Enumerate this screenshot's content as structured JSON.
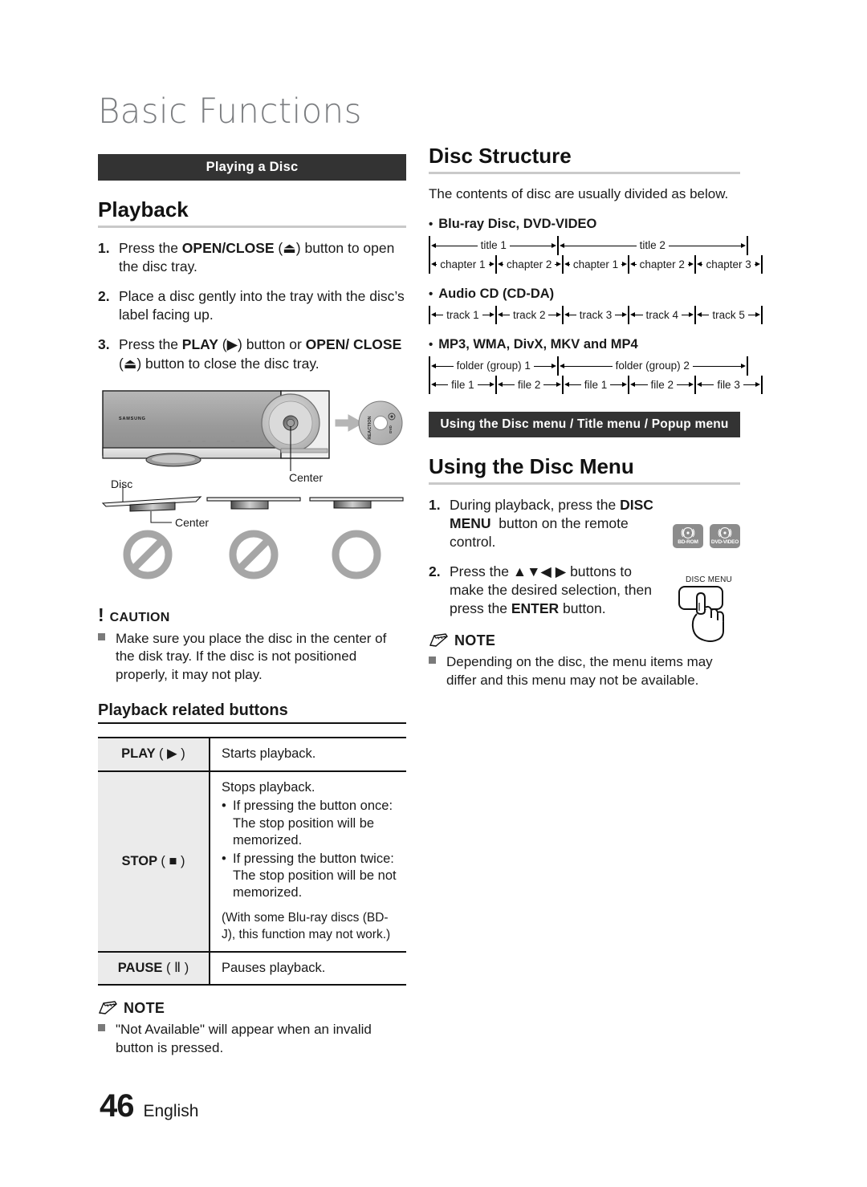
{
  "page": {
    "chapter_title": "Basic Functions",
    "folio_number": "46",
    "folio_language": "English",
    "bar_color": "#333333",
    "rule_color": "#c9c9c9",
    "table_key_bg": "#ebebeb",
    "badge_bg": "#8c8c8c"
  },
  "left_column": {
    "section_bar": "Playing a Disc",
    "heading": "Playback",
    "steps": [
      {
        "num": "1.",
        "html": "Press the <b>OPEN/CLOSE</b> (⏏) button to open the disc tray."
      },
      {
        "num": "2.",
        "html": "Place a disc gently into the tray with the disc’s label facing up."
      },
      {
        "num": "3.",
        "html": "Press the <b>PLAY</b> (▶) button or <b>OPEN/ CLOSE</b> (⏏) button to close the disc tray."
      }
    ],
    "illustration": {
      "player_brand": "SAMSUNG",
      "disc_label_text": "REACTION",
      "disc_logo_text": "DVD",
      "caption_center_top": "Center",
      "caption_disc": "Disc",
      "caption_center_bottom": "Center",
      "placement_marks": [
        "prohibited",
        "prohibited",
        "allowed"
      ]
    },
    "caution": {
      "glyph": "!",
      "label": "CAUTION",
      "items": [
        "Make sure you place the disc in the center of the disk tray. If the disc is not positioned properly, it may not play."
      ]
    },
    "sub_heading": "Playback related buttons",
    "table": {
      "rows": [
        {
          "key_label": "PLAY",
          "key_symbol": "▶",
          "desc_lines": [
            "Starts playback."
          ],
          "bullets": [],
          "paren_note": ""
        },
        {
          "key_label": "STOP",
          "key_symbol": "■",
          "desc_lines": [
            "Stops playback."
          ],
          "bullets": [
            "If pressing the button once: The stop position will be memorized.",
            "If pressing the button twice: The stop position will be not memorized."
          ],
          "paren_note": "(With some Blu-ray discs (BD-J), this function may not work.)"
        },
        {
          "key_label": "PAUSE",
          "key_symbol": "Ⅱ",
          "desc_lines": [
            "Pauses playback."
          ],
          "bullets": [],
          "paren_note": ""
        }
      ]
    },
    "note": {
      "label": "NOTE",
      "items": [
        "\"Not Available\" will appear when an invalid button is pressed."
      ]
    }
  },
  "right_column": {
    "heading_structure": "Disc Structure",
    "intro": "The contents of disc are usually divided as below.",
    "groups": [
      {
        "title": "Blu-ray Disc, DVD-VIDEO",
        "top_row": [
          "title 1",
          "title 2"
        ],
        "top_row_spans": [
          2,
          3
        ],
        "bottom_row": [
          "chapter 1",
          "chapter 2",
          "chapter 1",
          "chapter 2",
          "chapter 3"
        ]
      },
      {
        "title": "Audio CD (CD-DA)",
        "top_row": [],
        "top_row_spans": [],
        "bottom_row": [
          "track 1",
          "track 2",
          "track 3",
          "track 4",
          "track 5"
        ]
      },
      {
        "title": "MP3, WMA, DivX, MKV and MP4",
        "top_row": [
          "folder (group) 1",
          "folder (group) 2"
        ],
        "top_row_spans": [
          2,
          3
        ],
        "bottom_row": [
          "file 1",
          "file 2",
          "file 1",
          "file 2",
          "file 3"
        ]
      }
    ],
    "section_bar": "Using the Disc menu / Title menu / Popup menu",
    "heading_menu": "Using the Disc Menu",
    "badges": [
      {
        "name": "bd-rom-badge",
        "label": "BD-ROM"
      },
      {
        "name": "dvd-video-badge",
        "label": "DVD-VIDEO"
      }
    ],
    "remote_label": "DISC MENU",
    "steps": [
      {
        "num": "1.",
        "html": "During playback, press the <b>DISC MENU</b>&nbsp; button on the remote control."
      },
      {
        "num": "2.",
        "html": "Press the ▲▼◀ ▶ buttons to make the desired selection, then press the <b>ENTER</b> button."
      }
    ],
    "note": {
      "label": "NOTE",
      "items": [
        "Depending on the disc, the menu items may differ and this menu may not be available."
      ]
    }
  }
}
